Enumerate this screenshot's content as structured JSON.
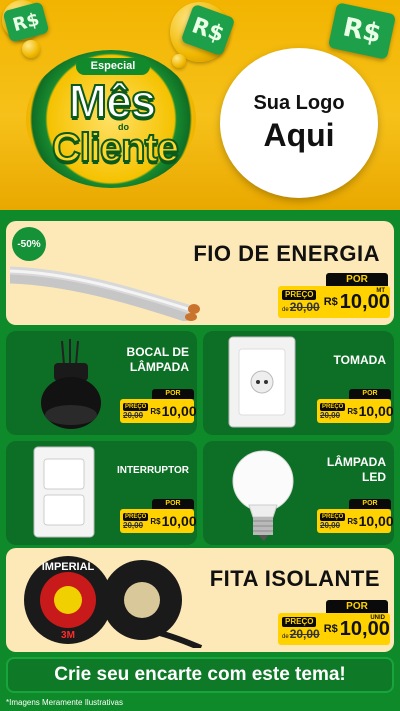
{
  "hero": {
    "badge_top": "Especial",
    "badge_main": "Mês",
    "badge_do": "do",
    "badge_bottom": "Cliente",
    "logo_line1": "Sua Logo",
    "logo_line2": "Aqui",
    "bill_symbol": "R$"
  },
  "products": [
    {
      "name": "FIO DE ENERGIA",
      "discount": "-50%",
      "por": "POR",
      "preco_label": "PREÇO",
      "de": "20,00",
      "de_prefix": "de",
      "rs": "R$",
      "value": "10,00",
      "unit": "MT"
    },
    {
      "name_lines": [
        "BOCAL DE",
        "LÂMPADA"
      ],
      "por": "POR",
      "preco_label": "PREÇO",
      "de": "20,00",
      "de_prefix": "de",
      "rs": "R$",
      "value": "10,00"
    },
    {
      "name_lines": [
        "TOMADA"
      ],
      "por": "POR",
      "preco_label": "PREÇO",
      "de": "20,00",
      "de_prefix": "de",
      "rs": "R$",
      "value": "10,00"
    },
    {
      "name_lines": [
        "INTERRUPTOR"
      ],
      "por": "POR",
      "preco_label": "PREÇO",
      "de": "20,00",
      "de_prefix": "de",
      "rs": "R$",
      "value": "10,00"
    },
    {
      "name_lines": [
        "LÂMPADA",
        "LED"
      ],
      "por": "POR",
      "preco_label": "PREÇO",
      "de": "20,00",
      "de_prefix": "de",
      "rs": "R$",
      "value": "10,00"
    },
    {
      "name": "FITA ISOLANTE",
      "por": "POR",
      "preco_label": "PREÇO",
      "de": "20,00",
      "de_prefix": "de",
      "rs": "R$",
      "value": "10,00",
      "unit": "UNID",
      "tape_brand": "IMPERIAL",
      "tape_label": "3M"
    }
  ],
  "cta": "Crie seu encarte com este tema!",
  "footnote": "*Imagens Meramente Ilustrativas",
  "colors": {
    "green": "#0f8a2a",
    "dark_green": "#0d6f25",
    "yellow": "#ffd200",
    "cream": "#fde9b8"
  }
}
